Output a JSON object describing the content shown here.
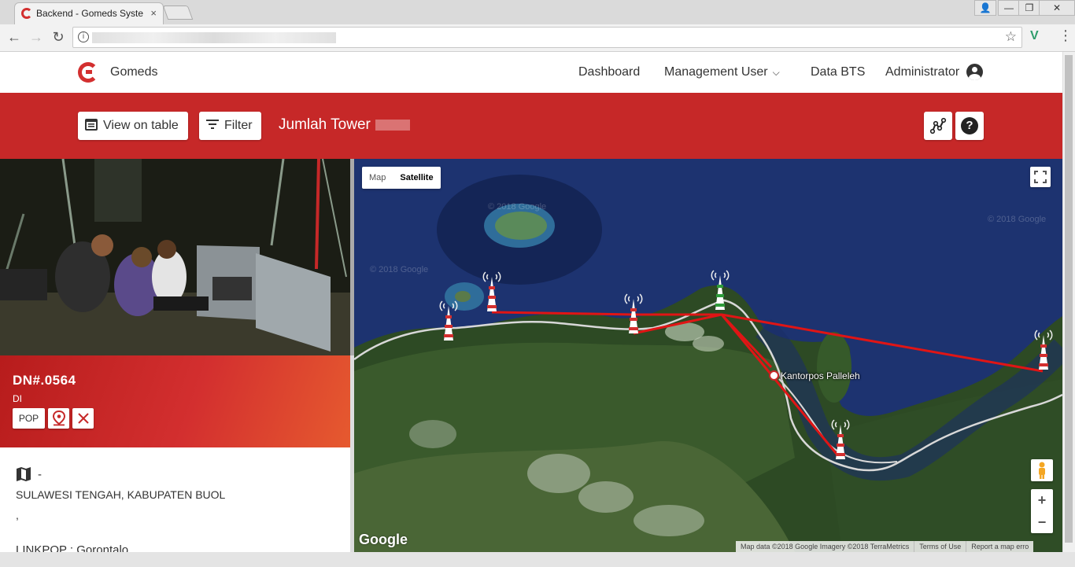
{
  "browser": {
    "tab_title": "Backend - Gomeds Syste",
    "tab_close": "×",
    "window_controls": {
      "minimize": "—",
      "restore": "❐",
      "close": "✕"
    },
    "nav": {
      "back": "←",
      "forward": "→",
      "reload": "↻"
    },
    "info_icon": "i",
    "bookmark_star": "☆",
    "extension_label": "V",
    "menu": "⋮"
  },
  "header": {
    "brand": "Gomeds",
    "nav": [
      {
        "label": "Dashboard"
      },
      {
        "label": "Management User"
      },
      {
        "label": "Data BTS"
      },
      {
        "label": "Administrator"
      }
    ]
  },
  "actionbar": {
    "view_on_table": "View on table",
    "filter": "Filter",
    "jumlah_tower": "Jumlah Tower"
  },
  "site": {
    "id": "DN#.0564",
    "sub": "DI",
    "chip_pop": "POP"
  },
  "details": {
    "location_dash": "-",
    "address": "SULAWESI TENGAH, KABUPATEN BUOL",
    "comma": ",",
    "linkpop": "LINKPOP : Gorontalo"
  },
  "map": {
    "type_map": "Map",
    "type_satellite": "Satellite",
    "selected_type": "Satellite",
    "poi": "Kantorpos Palleleh",
    "google_logo": "Google",
    "zoom_in": "+",
    "zoom_out": "−",
    "attribution": [
      "Map data ©2018 Google Imagery ©2018 TerraMetrics",
      "Terms of Use",
      "Report a map erro"
    ],
    "watermarks": [
      "© 2018 Google",
      "© 2018 Google",
      "© 2018 Google"
    ]
  },
  "colors": {
    "brand_red": "#c62828",
    "route_red": "#e01515",
    "tower_active": "#2e9c3a"
  }
}
